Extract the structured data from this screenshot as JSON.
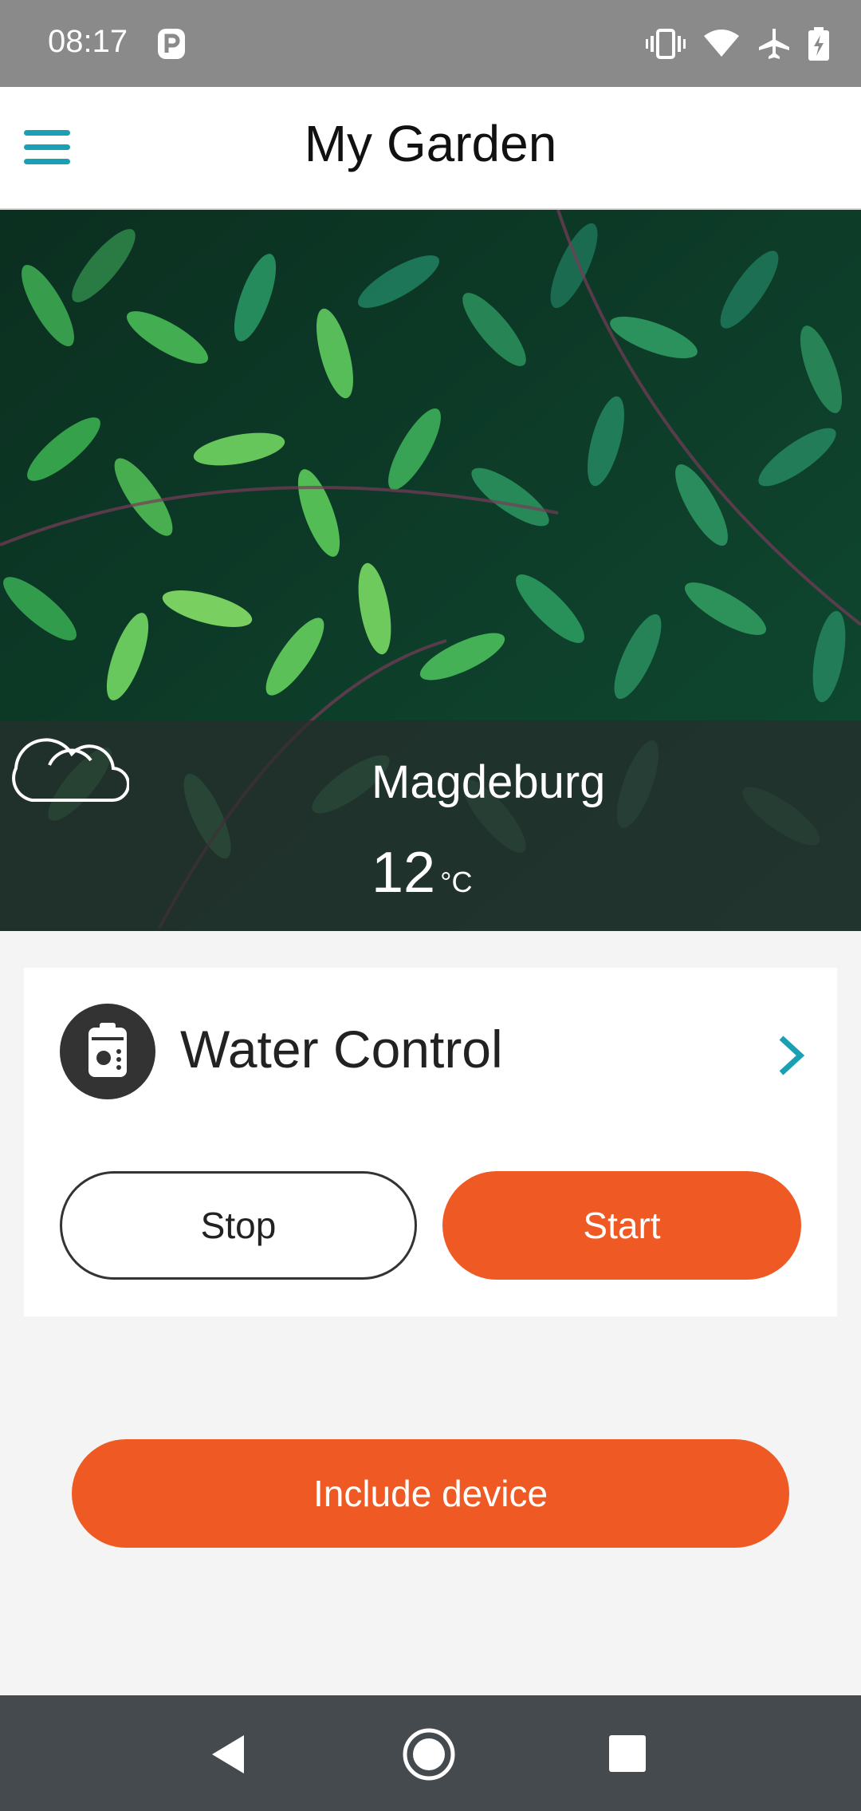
{
  "status_bar": {
    "time": "08:17",
    "icons": [
      "parking-icon",
      "vibrate-icon",
      "wifi-icon",
      "airplane-icon",
      "battery-charging-icon"
    ]
  },
  "app_bar": {
    "title": "My Garden",
    "menu_icon": "hamburger-menu-icon"
  },
  "weather": {
    "city": "Magdeburg",
    "temperature": "12",
    "unit": "°C",
    "icon": "cloud-icon"
  },
  "device_card": {
    "name": "Water Control",
    "icon": "water-control-device-icon",
    "stop_label": "Stop",
    "start_label": "Start"
  },
  "include_label": "Include device",
  "colors": {
    "accent": "#1aa0b4",
    "primary_button": "#ef5a24",
    "status_bar": "#8a8a8a",
    "nav_bar": "#454a4f"
  }
}
